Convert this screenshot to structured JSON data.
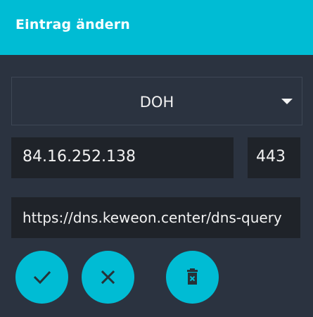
{
  "dialog": {
    "title": "Eintrag ändern",
    "protocol": {
      "selected": "DOH"
    },
    "ip_address": "84.16.252.138",
    "port": "443",
    "url": "https://dns.keweon.center/dns-query"
  },
  "icons": {
    "confirm": "check-icon",
    "cancel": "close-icon",
    "delete": "trash-icon",
    "dropdown": "caret-down-icon"
  },
  "colors": {
    "accent": "#00bcd4",
    "background": "#2b3340",
    "field_background": "#1f2329",
    "text": "#f2f2f2"
  }
}
